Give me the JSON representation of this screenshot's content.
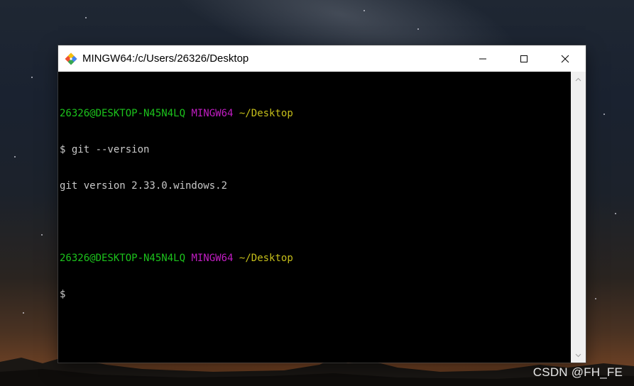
{
  "window": {
    "title": "MINGW64:/c/Users/26326/Desktop",
    "app_icon": "git-icon",
    "controls": [
      "minimize-icon",
      "maximize-icon",
      "close-icon"
    ]
  },
  "terminal": {
    "lines": [
      {
        "user_host": "26326@DESKTOP-N45N4LQ",
        "shell": "MINGW64",
        "path": "~/Desktop"
      },
      {
        "text": "$ git --version"
      },
      {
        "text": "git version 2.33.0.windows.2"
      },
      {
        "text": ""
      },
      {
        "user_host": "26326@DESKTOP-N45N4LQ",
        "shell": "MINGW64",
        "path": "~/Desktop"
      },
      {
        "text": "$"
      }
    ],
    "colors": {
      "background": "#000000",
      "user_host": "#1cc31c",
      "shell": "#c11dc2",
      "path": "#c6bf1a",
      "text": "#c9c9c9"
    }
  },
  "watermark": "CSDN @FH_FE"
}
